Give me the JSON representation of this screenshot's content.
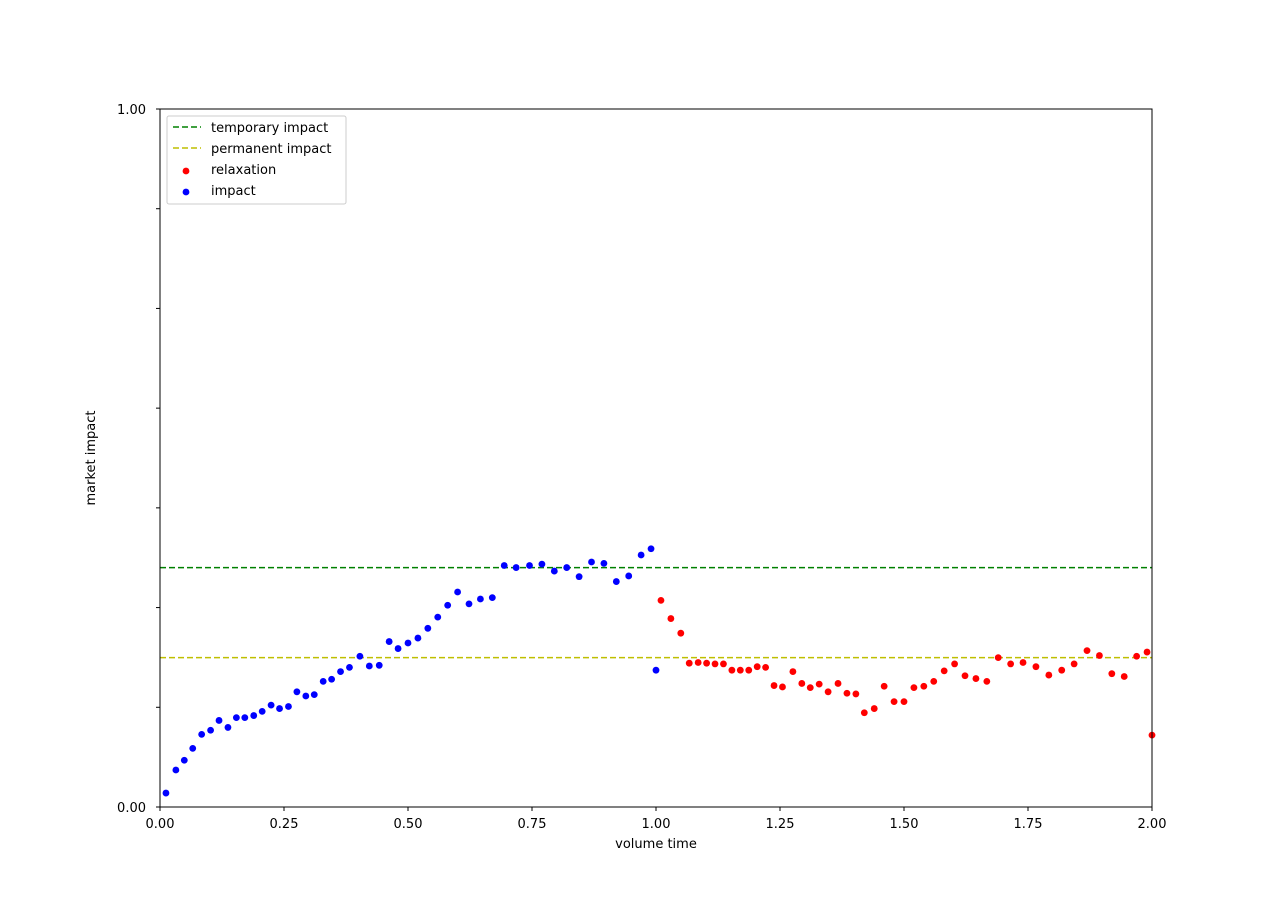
{
  "chart_data": {
    "type": "scatter",
    "title": "",
    "xlabel": "volume time",
    "ylabel": "market impact",
    "xlim": [
      0,
      2
    ],
    "ylim": [
      0,
      1
    ],
    "x_ticks": [
      0,
      0.25,
      0.5,
      0.75,
      1.0,
      1.25,
      1.5,
      1.75,
      2.0
    ],
    "x_tick_labels": [
      "0.00",
      "0.25",
      "0.50",
      "0.75",
      "1.00",
      "1.25",
      "1.50",
      "1.75",
      "2.00"
    ],
    "y_ticks": [
      0,
      0.142857,
      0.285714,
      0.428571,
      0.571429,
      0.714286,
      0.857143,
      1.0
    ],
    "y_tick_labels": [
      "0.00",
      "",
      "",
      "",
      "",
      "",
      "",
      "1.00"
    ],
    "grid": false,
    "legend_position": "top-left",
    "hlines": [
      {
        "name": "temporary impact",
        "y": 0.343,
        "color": "#008000",
        "style": "dashed"
      },
      {
        "name": "permanent impact",
        "y": 0.214,
        "color": "#bfbf00",
        "style": "dashed"
      }
    ],
    "series": [
      {
        "name": "relaxation",
        "color": "#ff0000",
        "x": [
          1.01,
          1.03,
          1.05,
          1.067,
          1.085,
          1.102,
          1.119,
          1.136,
          1.153,
          1.17,
          1.187,
          1.204,
          1.221,
          1.238,
          1.255,
          1.276,
          1.294,
          1.311,
          1.329,
          1.347,
          1.367,
          1.385,
          1.403,
          1.42,
          1.44,
          1.46,
          1.48,
          1.5,
          1.52,
          1.54,
          1.56,
          1.581,
          1.602,
          1.623,
          1.645,
          1.667,
          1.69,
          1.715,
          1.74,
          1.766,
          1.792,
          1.818,
          1.843,
          1.869,
          1.894,
          1.919,
          1.944,
          1.969,
          1.99,
          2.0
        ],
        "y": [
          0.296,
          0.27,
          0.249,
          0.206,
          0.207,
          0.206,
          0.205,
          0.205,
          0.196,
          0.196,
          0.196,
          0.201,
          0.2,
          0.174,
          0.172,
          0.194,
          0.177,
          0.171,
          0.176,
          0.165,
          0.177,
          0.163,
          0.162,
          0.135,
          0.141,
          0.173,
          0.151,
          0.151,
          0.171,
          0.173,
          0.18,
          0.195,
          0.205,
          0.188,
          0.184,
          0.18,
          0.214,
          0.205,
          0.207,
          0.201,
          0.189,
          0.196,
          0.205,
          0.224,
          0.217,
          0.191,
          0.187,
          0.216,
          0.222,
          0.103
        ]
      },
      {
        "name": "impact",
        "color": "#0000ff",
        "x": [
          0.012,
          0.032,
          0.049,
          0.066,
          0.084,
          0.102,
          0.119,
          0.137,
          0.154,
          0.171,
          0.189,
          0.206,
          0.224,
          0.241,
          0.259,
          0.276,
          0.294,
          0.311,
          0.329,
          0.346,
          0.364,
          0.382,
          0.403,
          0.422,
          0.442,
          0.462,
          0.48,
          0.5,
          0.52,
          0.54,
          0.56,
          0.58,
          0.6,
          0.623,
          0.646,
          0.67,
          0.694,
          0.718,
          0.745,
          0.77,
          0.795,
          0.82,
          0.845,
          0.87,
          0.895,
          0.92,
          0.945,
          0.97,
          0.99,
          1.0
        ],
        "y": [
          0.02,
          0.053,
          0.067,
          0.084,
          0.104,
          0.11,
          0.124,
          0.114,
          0.128,
          0.128,
          0.131,
          0.137,
          0.146,
          0.141,
          0.144,
          0.165,
          0.159,
          0.161,
          0.18,
          0.183,
          0.194,
          0.2,
          0.216,
          0.202,
          0.203,
          0.237,
          0.227,
          0.235,
          0.242,
          0.256,
          0.272,
          0.289,
          0.308,
          0.291,
          0.298,
          0.3,
          0.346,
          0.343,
          0.346,
          0.348,
          0.338,
          0.343,
          0.33,
          0.351,
          0.349,
          0.323,
          0.331,
          0.361,
          0.37,
          0.196
        ]
      }
    ]
  }
}
